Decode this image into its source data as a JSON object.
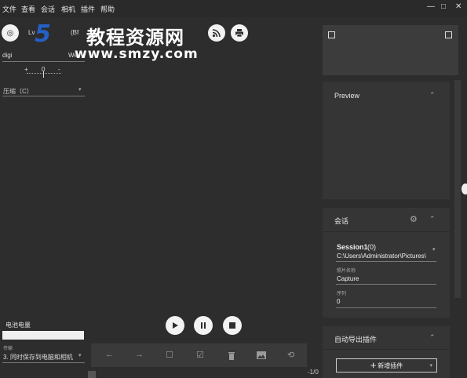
{
  "menu": [
    "文件",
    "查看",
    "会话",
    "相机",
    "插件",
    "帮助"
  ],
  "window_controls": {
    "minimize": "—",
    "maximize": "□",
    "close": "✕"
  },
  "toolbar": {
    "left_label": "digi",
    "right_label": "We",
    "lv_label": "Lv",
    "bf_label": "(Bf",
    "ruler_value": "0",
    "plus": "+",
    "minus": "-"
  },
  "watermark": {
    "brand": "教程资源网",
    "url": "www.smzy.com"
  },
  "compression": {
    "label": "压缩（C）"
  },
  "battery": {
    "label": "电池电量"
  },
  "transfer": {
    "label": "传输",
    "value": "3. 同时保存到电脑和相机"
  },
  "counter": "-1/0",
  "preview_panel": {
    "title": "Preview"
  },
  "session_panel": {
    "title": "会话",
    "name": "Session1",
    "count": "(0)",
    "path": "C:\\Users\\Administrator\\Pictures\\",
    "photo_name_label": "照片名称",
    "photo_name_value": "Capture",
    "sequence_label": "序列",
    "sequence_value": "0"
  },
  "plugin_panel": {
    "title": "自动导出插件",
    "add_button": "新增插件"
  },
  "icons": [
    "aperture-icon",
    "rss-icon",
    "printer-icon",
    "play-icon",
    "pause-icon",
    "stop-icon",
    "arrow-left-icon",
    "arrow-right-icon",
    "square-icon",
    "checkbox-icon",
    "trash-icon",
    "image-icon",
    "history-icon",
    "gear-icon",
    "chevron-up-icon"
  ]
}
